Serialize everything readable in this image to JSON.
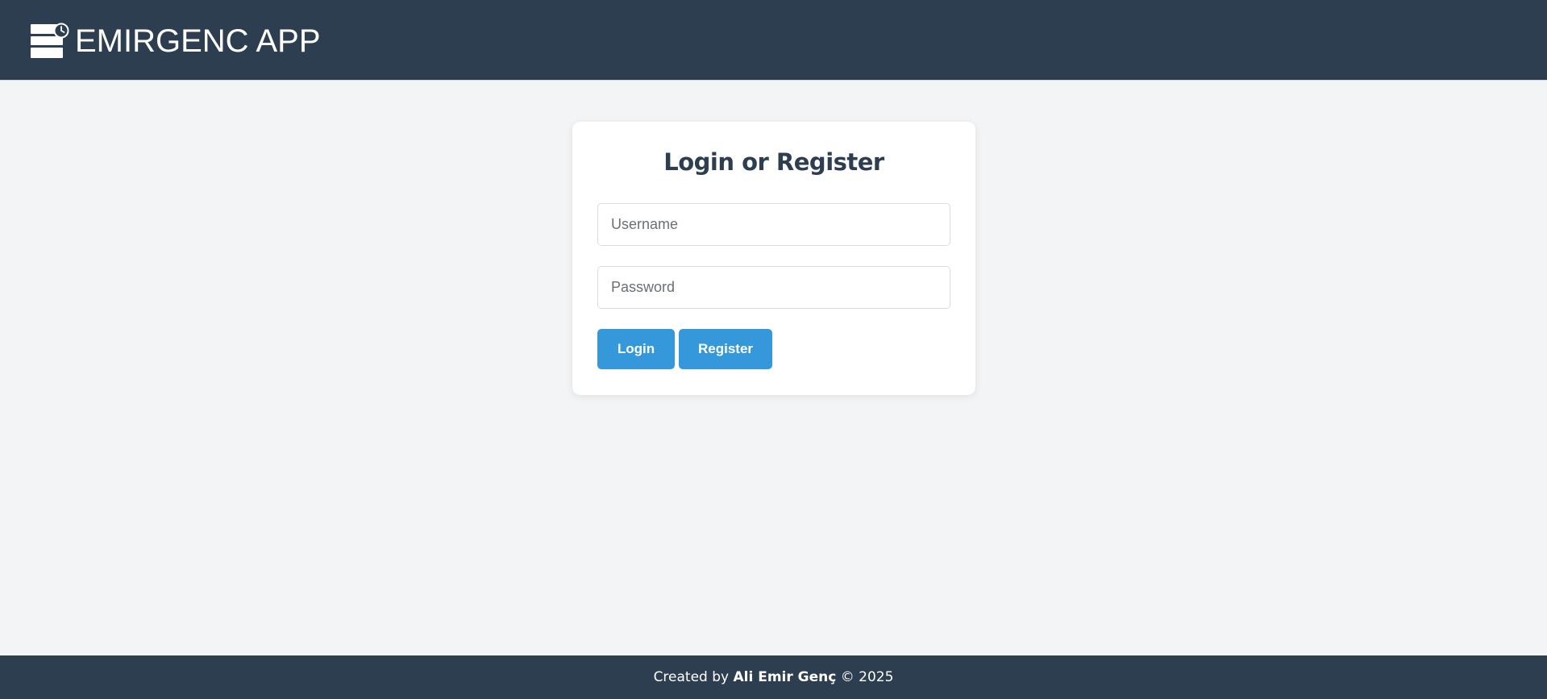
{
  "header": {
    "brand_name": "EMIRGENC APP",
    "logo_icon": "stacked-books-clock-icon",
    "background_color": "#2c3e50"
  },
  "login_card": {
    "title": "Login or Register",
    "username": {
      "value": "",
      "placeholder": "Username"
    },
    "password": {
      "value": "",
      "placeholder": "Password"
    },
    "login_label": "Login",
    "register_label": "Register",
    "button_color": "#3498db"
  },
  "footer": {
    "prefix": "Created by ",
    "author": "Ali Emir Genç",
    "suffix": " © 2025"
  }
}
